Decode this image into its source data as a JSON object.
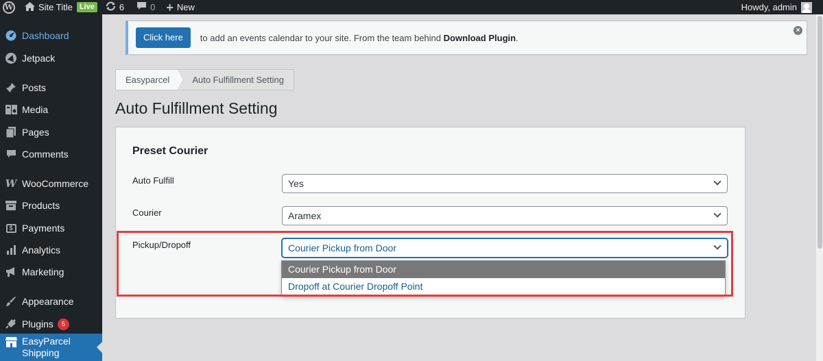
{
  "adminbar": {
    "site_title": "Site Title",
    "live_badge": "Live",
    "updates_count": "6",
    "comments_count": "0",
    "new_label": "New",
    "howdy": "Howdy, admin"
  },
  "sidebar": {
    "items": [
      {
        "label": "Dashboard",
        "icon": "dashboard-icon"
      },
      {
        "label": "Jetpack",
        "icon": "jetpack-icon"
      },
      {
        "label": "Posts",
        "icon": "pin-icon"
      },
      {
        "label": "Media",
        "icon": "media-icon"
      },
      {
        "label": "Pages",
        "icon": "pages-icon"
      },
      {
        "label": "Comments",
        "icon": "comment-icon"
      },
      {
        "label": "WooCommerce",
        "icon": "woocommerce-icon"
      },
      {
        "label": "Products",
        "icon": "archive-icon"
      },
      {
        "label": "Payments",
        "icon": "payments-icon"
      },
      {
        "label": "Analytics",
        "icon": "analytics-icon"
      },
      {
        "label": "Marketing",
        "icon": "megaphone-icon"
      },
      {
        "label": "Appearance",
        "icon": "brush-icon"
      },
      {
        "label": "Plugins",
        "icon": "plugin-icon",
        "badge": "5"
      },
      {
        "label": "EasyParcel Shipping",
        "icon": "store-icon"
      }
    ]
  },
  "notice": {
    "button_label": "Click here",
    "text": "to add an events calendar to your site. From the team behind",
    "text_bold": "Download Plugin",
    "text_end": "."
  },
  "breadcrumb": {
    "items": [
      "Easyparcel",
      "Auto Fulfillment Setting"
    ]
  },
  "page": {
    "title": "Auto Fulfillment Setting"
  },
  "form": {
    "heading": "Preset Courier",
    "fields": [
      {
        "label": "Auto Fulfill",
        "value": "Yes"
      },
      {
        "label": "Courier",
        "value": "Aramex"
      },
      {
        "label": "Pickup/Dropoff",
        "value": "Courier Pickup from Door"
      }
    ],
    "dropdown_options": [
      "Courier Pickup from Door",
      "Dropoff at Courier Dropoff Point"
    ],
    "selected_option": "Courier Pickup from Door"
  },
  "colors": {
    "adminbar_bg": "#1d2327",
    "accent_blue": "#2271b1",
    "highlight_red": "#e63b3b",
    "live_green": "#74b84a",
    "badge_red": "#d63638"
  }
}
